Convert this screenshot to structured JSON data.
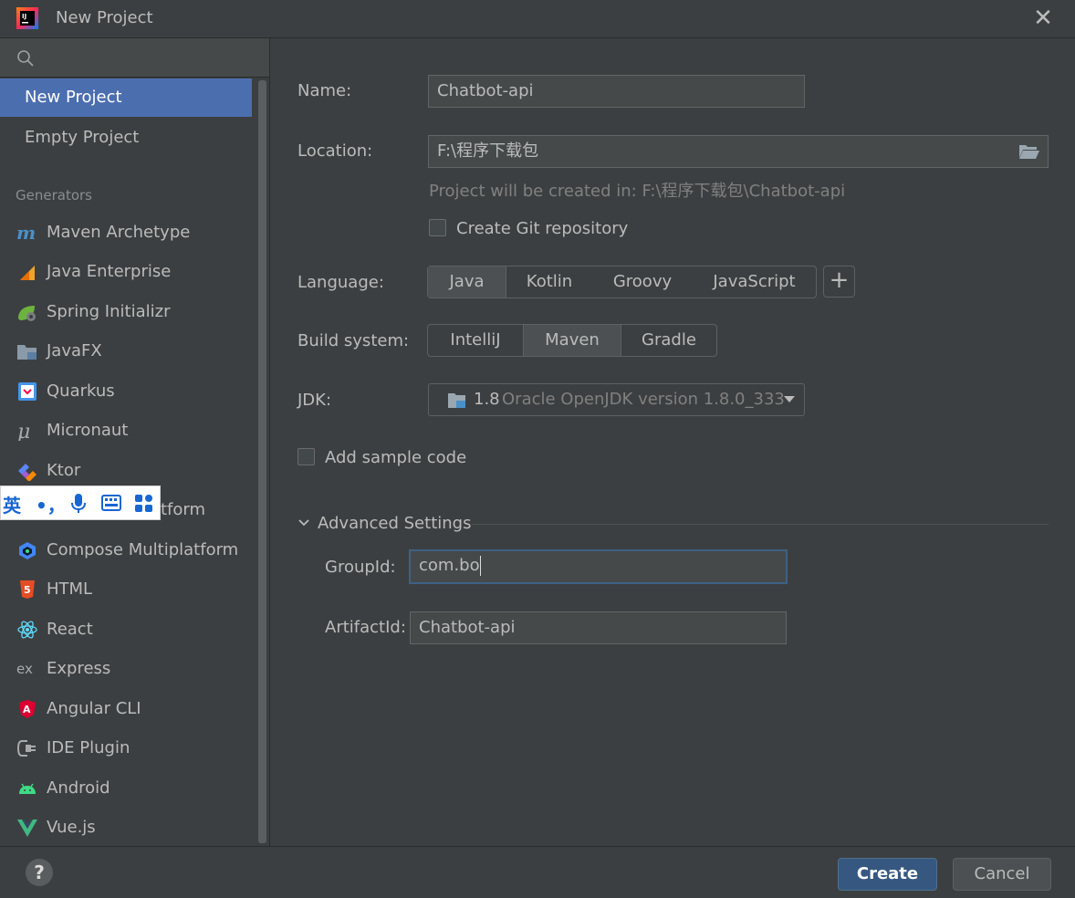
{
  "window": {
    "title": "New Project"
  },
  "sidebar": {
    "top_items": [
      {
        "label": "New Project",
        "selected": true
      },
      {
        "label": "Empty Project",
        "selected": false
      }
    ],
    "section_label": "Generators",
    "generators": [
      {
        "label": "Maven Archetype",
        "icon": "maven-icon"
      },
      {
        "label": "Java Enterprise",
        "icon": "java-enterprise-icon"
      },
      {
        "label": "Spring Initializr",
        "icon": "spring-icon"
      },
      {
        "label": "JavaFX",
        "icon": "javafx-icon"
      },
      {
        "label": "Quarkus",
        "icon": "quarkus-icon"
      },
      {
        "label": "Micronaut",
        "icon": "micronaut-icon"
      },
      {
        "label": "Ktor",
        "icon": "ktor-icon"
      },
      {
        "label": "tform",
        "icon": "kotlin-multiplatform-icon"
      },
      {
        "label": "Compose Multiplatform",
        "icon": "compose-icon"
      },
      {
        "label": "HTML",
        "icon": "html5-icon"
      },
      {
        "label": "React",
        "icon": "react-icon"
      },
      {
        "label": "Express",
        "icon": "express-icon"
      },
      {
        "label": "Angular CLI",
        "icon": "angular-icon"
      },
      {
        "label": "IDE Plugin",
        "icon": "plugin-icon"
      },
      {
        "label": "Android",
        "icon": "android-icon"
      },
      {
        "label": "Vue.js",
        "icon": "vue-icon"
      }
    ]
  },
  "ime_toolbar": {
    "lang": "英",
    "punct": "•，"
  },
  "form": {
    "name_label": "Name:",
    "name_value": "Chatbot-api",
    "location_label": "Location:",
    "location_value": "F:\\程序下载包",
    "location_hint": "Project will be created in: F:\\程序下载包\\Chatbot-api",
    "git_label": "Create Git repository",
    "git_checked": false,
    "language_label": "Language:",
    "languages": [
      {
        "label": "Java",
        "active": true
      },
      {
        "label": "Kotlin",
        "active": false
      },
      {
        "label": "Groovy",
        "active": false
      },
      {
        "label": "JavaScript",
        "active": false
      }
    ],
    "add_language": "+",
    "build_label": "Build system:",
    "build_systems": [
      {
        "label": "IntelliJ",
        "active": false
      },
      {
        "label": "Maven",
        "active": true
      },
      {
        "label": "Gradle",
        "active": false
      }
    ],
    "jdk_label": "JDK:",
    "jdk_version": "1.8",
    "jdk_detail": "Oracle OpenJDK version 1.8.0_333",
    "sample_label": "Add sample code",
    "sample_checked": false,
    "advanced_label": "Advanced Settings",
    "groupid_label": "GroupId:",
    "groupid_value": "com.bo",
    "artifactid_label": "ArtifactId:",
    "artifactid_value": "Chatbot-api"
  },
  "footer": {
    "help": "?",
    "create": "Create",
    "cancel": "Cancel"
  },
  "colors": {
    "background": "#3c3f41",
    "selection": "#4b6eaf",
    "primary_button": "#365880"
  }
}
